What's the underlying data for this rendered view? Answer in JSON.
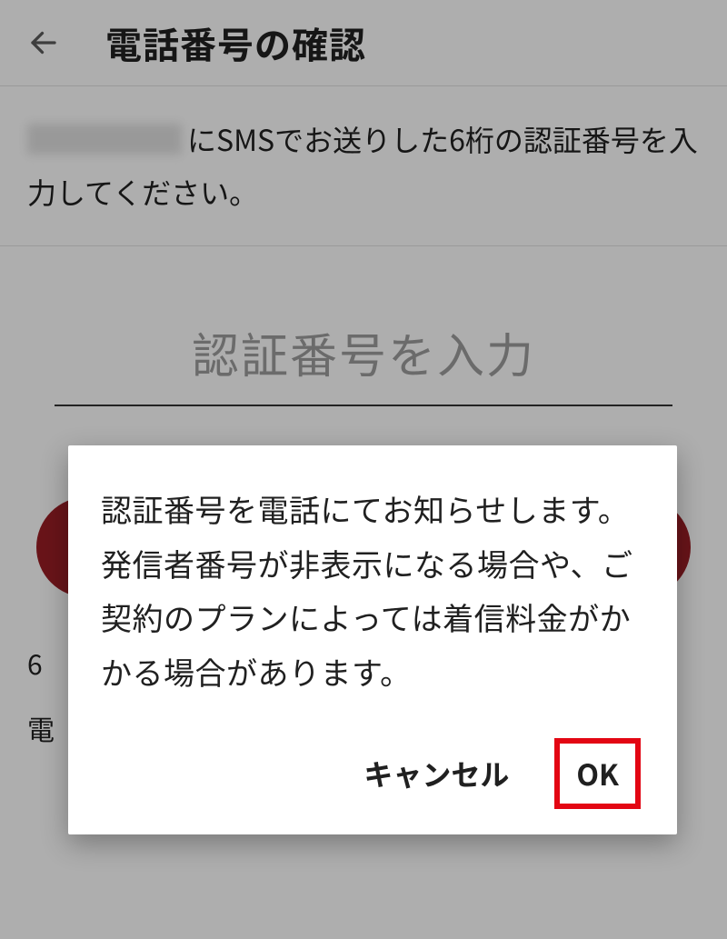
{
  "header": {
    "title": "電話番号の確認"
  },
  "instruction": {
    "suffix": "にSMSでお送りした6桁の認証番号を入力してください。"
  },
  "code": {
    "placeholder": "認証番号を入力"
  },
  "hint": {
    "line1": "6",
    "line2": "電"
  },
  "dialog": {
    "body": "認証番号を電話にてお知らせします。\n発信者番号が非表示になる場合や、ご契約のプランによっては着信料金がかかる場合があります。",
    "cancel": "キャンセル",
    "ok": "OK"
  }
}
